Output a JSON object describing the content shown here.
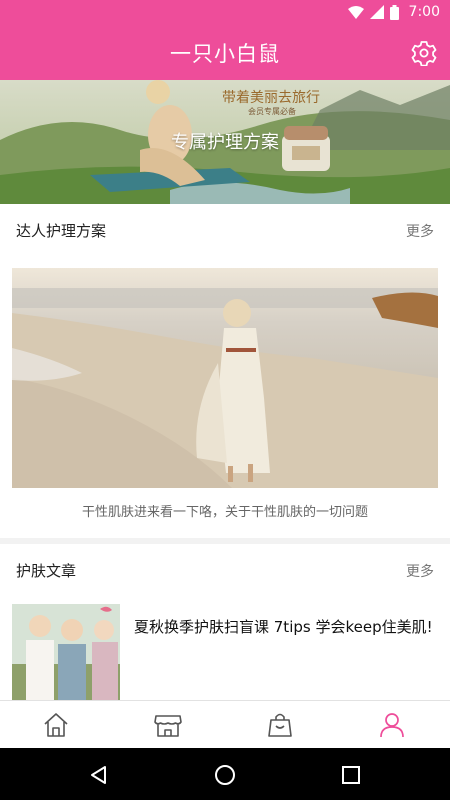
{
  "status_bar": {
    "time": "7:00",
    "icons": [
      "wifi-icon",
      "signal-icon",
      "battery-icon"
    ]
  },
  "app_bar": {
    "title": "一只小白鼠",
    "settings_icon": "gear-icon"
  },
  "banner": {
    "title": "专属护理方案",
    "slogan": "带着美丽去旅行",
    "slogan_sub": "会员专属必备"
  },
  "section_plans": {
    "title": "达人护理方案",
    "more": "更多"
  },
  "feature": {
    "caption": "干性肌肤进来看一下咯，关于干性肌肤的一切问题"
  },
  "section_articles": {
    "title": "护肤文章",
    "more": "更多"
  },
  "articles": [
    {
      "title": "夏秋换季护肤扫盲课 7tips 学会keep住美肌!"
    }
  ],
  "bottom_nav": {
    "items": [
      {
        "icon": "home-icon",
        "active": false
      },
      {
        "icon": "store-icon",
        "active": false
      },
      {
        "icon": "shopping-bag-icon",
        "active": false
      },
      {
        "icon": "profile-icon",
        "active": true
      }
    ]
  },
  "system_nav": {
    "icons": [
      "back-icon",
      "home-circle-icon",
      "recents-icon"
    ]
  },
  "colors": {
    "accent": "#ee4d9a",
    "active_nav": "#ee4d9a",
    "inactive_nav": "#555555"
  }
}
